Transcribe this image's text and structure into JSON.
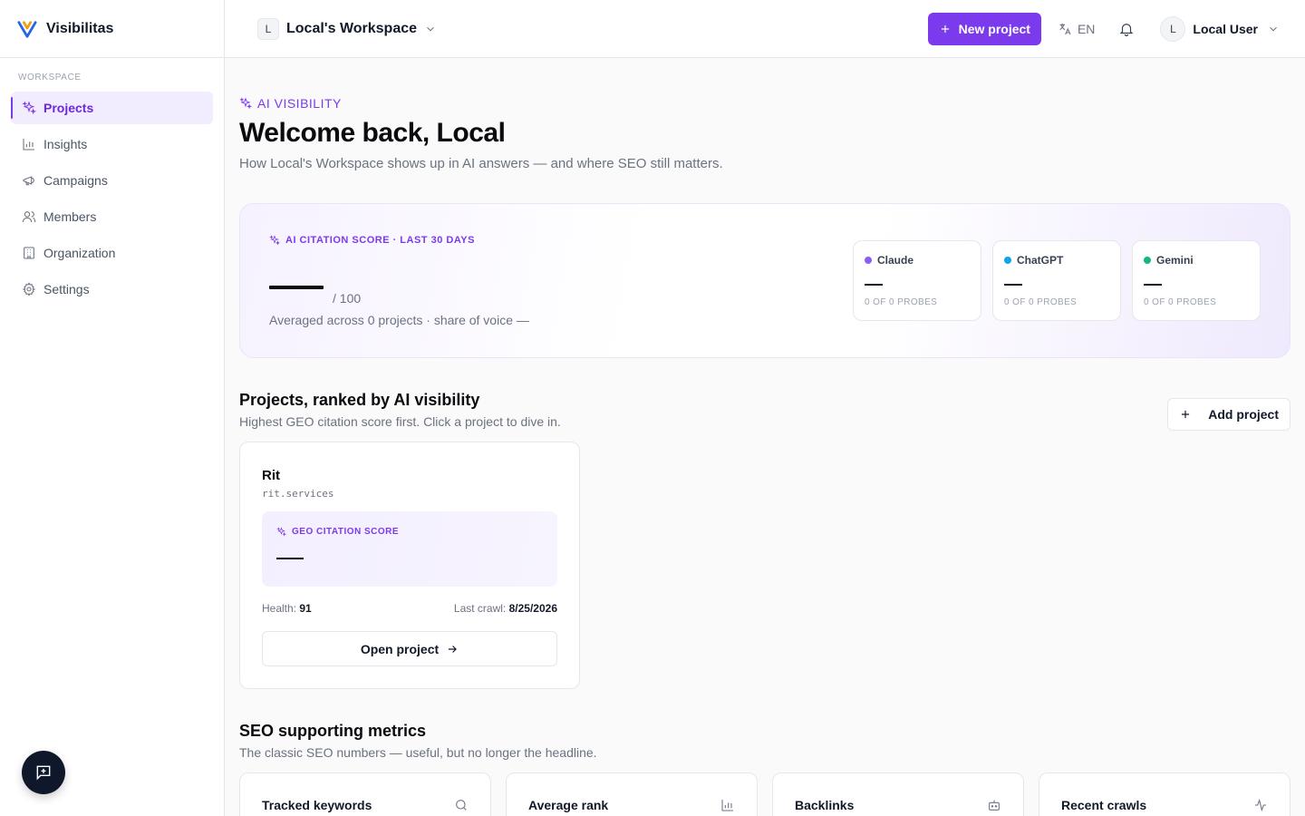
{
  "brand": {
    "name": "Visibilitas"
  },
  "sidebar": {
    "heading": "WORKSPACE",
    "items": [
      {
        "label": "Projects",
        "icon": "sparkles-icon",
        "active": true
      },
      {
        "label": "Insights",
        "icon": "bar-chart-icon"
      },
      {
        "label": "Campaigns",
        "icon": "megaphone-icon"
      },
      {
        "label": "Members",
        "icon": "users-icon"
      },
      {
        "label": "Organization",
        "icon": "building-icon"
      },
      {
        "label": "Settings",
        "icon": "gear-icon"
      }
    ]
  },
  "topbar": {
    "workspace_initial": "L",
    "workspace_name": "Local's Workspace",
    "new_project_label": "New project",
    "language": "EN",
    "user_initial": "L",
    "user_name": "Local User"
  },
  "main": {
    "kicker": "AI VISIBILITY",
    "title": "Welcome back, Local",
    "subtitle": "How Local's Workspace shows up in AI answers — and where SEO still matters.",
    "score_card": {
      "kicker": "AI CITATION SCORE · LAST 30 DAYS",
      "score_max": "/ 100",
      "note": "Averaged across 0 projects · share of voice —",
      "engines": [
        {
          "name": "Claude",
          "color": "#8b5cf6",
          "probes": "0 OF 0 PROBES"
        },
        {
          "name": "ChatGPT",
          "color": "#0ea5e9",
          "probes": "0 OF 0 PROBES"
        },
        {
          "name": "Gemini",
          "color": "#10b981",
          "probes": "0 OF 0 PROBES"
        }
      ]
    },
    "projects_section": {
      "title": "Projects, ranked by AI visibility",
      "subtitle": "Highest GEO citation score first. Click a project to dive in.",
      "add_label": "Add project",
      "projects": [
        {
          "name": "Rit",
          "domain": "rit.services",
          "geo_kicker": "GEO CITATION SCORE",
          "health_label": "Health:",
          "health_value": "91",
          "crawl_label": "Last crawl:",
          "crawl_value": "8/25/2026",
          "open_label": "Open project"
        }
      ]
    },
    "seo_section": {
      "title": "SEO supporting metrics",
      "subtitle": "The classic SEO numbers — useful, but no longer the headline.",
      "metrics": [
        {
          "label": "Tracked keywords",
          "icon": "search-icon"
        },
        {
          "label": "Average rank",
          "icon": "bar-chart-icon"
        },
        {
          "label": "Backlinks",
          "icon": "bot-icon"
        },
        {
          "label": "Recent crawls",
          "icon": "activity-icon"
        }
      ]
    }
  },
  "colors": {
    "accent": "#7c3aed",
    "accent_soft": "#f1ecfe"
  }
}
